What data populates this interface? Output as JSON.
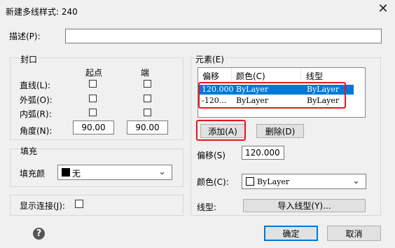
{
  "window": {
    "title": "新建多线样式: 240",
    "close_glyph": "✕"
  },
  "description": {
    "label": "描述(P):",
    "value": ""
  },
  "caps": {
    "title": "封口",
    "col_start": "起点",
    "col_end": "端",
    "rows": [
      {
        "label": "直线(L):"
      },
      {
        "label": "外弧(O):"
      },
      {
        "label": "内弧(R):"
      }
    ],
    "angle": {
      "label": "角度(N):",
      "start": "90.00",
      "end": "90.00"
    }
  },
  "fill": {
    "title": "填充",
    "label": "填充颜",
    "value": "无",
    "swatch_color": "#000000"
  },
  "display_joints": {
    "label": "显示连接(J):"
  },
  "elements": {
    "title": "元素(E)",
    "headers": [
      "偏移",
      "颜色(C)",
      "线型"
    ],
    "rows": [
      {
        "offset": "120.000",
        "color": "ByLayer",
        "linetype": "ByLayer",
        "selected": true
      },
      {
        "offset": "-120...",
        "color": "ByLayer",
        "linetype": "ByLayer",
        "selected": false
      }
    ],
    "add_button": "添加(A)",
    "delete_button": "删除(D)",
    "offset_label": "偏移(S)",
    "offset_value": "120.000",
    "color_label": "颜色(C):",
    "color_value": "ByLayer",
    "linetype_label": "线型:",
    "load_linetype_button": "导入线型(Y)..."
  },
  "footer": {
    "help_glyph": "?",
    "ok": "确定",
    "cancel": "取消"
  },
  "colors": {
    "highlight": "#e8161c",
    "selection": "#0078d7"
  }
}
